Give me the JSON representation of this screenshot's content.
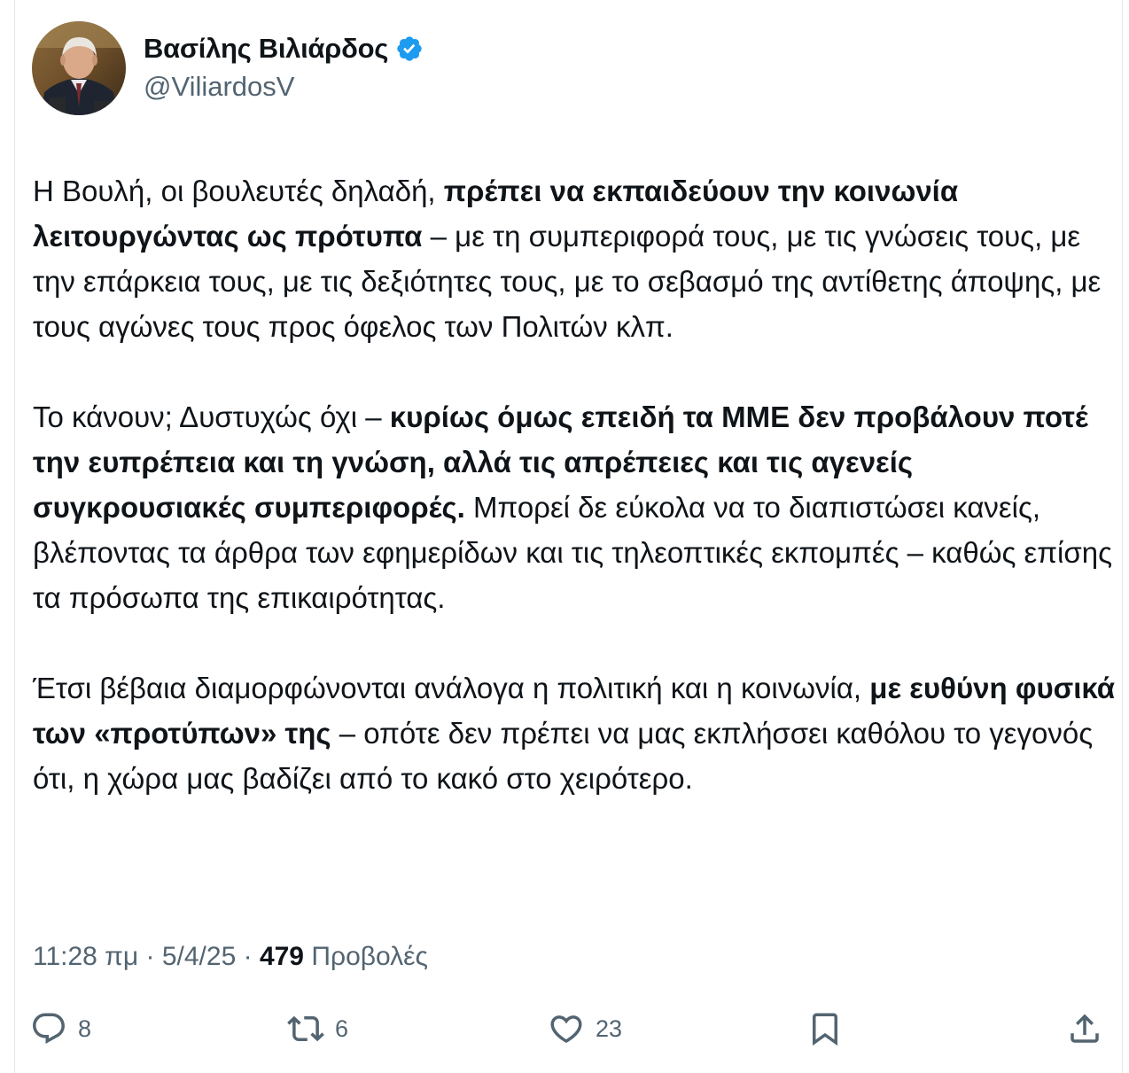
{
  "author": {
    "display_name": "Βασίλης Βιλιάρδος",
    "handle": "@ViliardosV",
    "verified": true,
    "verified_color": "#1d9bf0"
  },
  "tweet": {
    "paragraphs": [
      [
        {
          "text": "Η Βουλή, οι βουλευτές δηλαδή, ",
          "bold": false
        },
        {
          "text": "πρέπει να εκπαιδεύουν την κοινωνία λειτουργώντας ως πρότυπα",
          "bold": true
        },
        {
          "text": " – με τη συμπεριφορά τους, με τις γνώσεις τους, με την επάρκεια τους, με τις δεξιότητες τους, με το σεβασμό της αντίθετης άποψης, με τους αγώνες τους προς όφελος των Πολιτών κλπ.",
          "bold": false
        }
      ],
      [
        {
          "text": "Το κάνουν; Δυστυχώς όχι – ",
          "bold": false
        },
        {
          "text": "κυρίως όμως επειδή τα ΜΜΕ δεν προβάλουν ποτέ την ευπρέπεια και τη γνώση, αλλά τις απρέπειες και τις αγενείς συγκρουσιακές συμπεριφορές.",
          "bold": true
        },
        {
          "text": " Μπορεί δε εύκολα να το διαπιστώσει κανείς, βλέποντας τα άρθρα των εφημερίδων και τις τηλεοπτικές εκπομπές – καθώς επίσης τα πρόσωπα της επικαιρότητας.",
          "bold": false
        }
      ],
      [
        {
          "text": "Έτσι βέβαια διαμορφώνονται ανάλογα η πολιτική και η κοινωνία, ",
          "bold": false
        },
        {
          "text": "με ευθύνη φυσικά των «προτύπων» της",
          "bold": true
        },
        {
          "text": " – οπότε δεν πρέπει να μας εκπλήσσει καθόλου το γεγονός ότι, η χώρα μας βαδίζει από το κακό στο χειρότερο.",
          "bold": false
        }
      ]
    ]
  },
  "meta": {
    "time": "11:28 πμ",
    "separator": " · ",
    "date": "5/4/25",
    "views_count": "479",
    "views_label": " Προβολές"
  },
  "actions": {
    "reply": {
      "icon": "reply-icon",
      "count": "8"
    },
    "repost": {
      "icon": "repost-icon",
      "count": "6"
    },
    "like": {
      "icon": "heart-icon",
      "count": "23"
    },
    "bookmark": {
      "icon": "bookmark-icon"
    },
    "share": {
      "icon": "share-icon"
    }
  },
  "colors": {
    "text_primary": "#0f1419",
    "text_secondary": "#536471",
    "border": "#e6e6e6"
  }
}
